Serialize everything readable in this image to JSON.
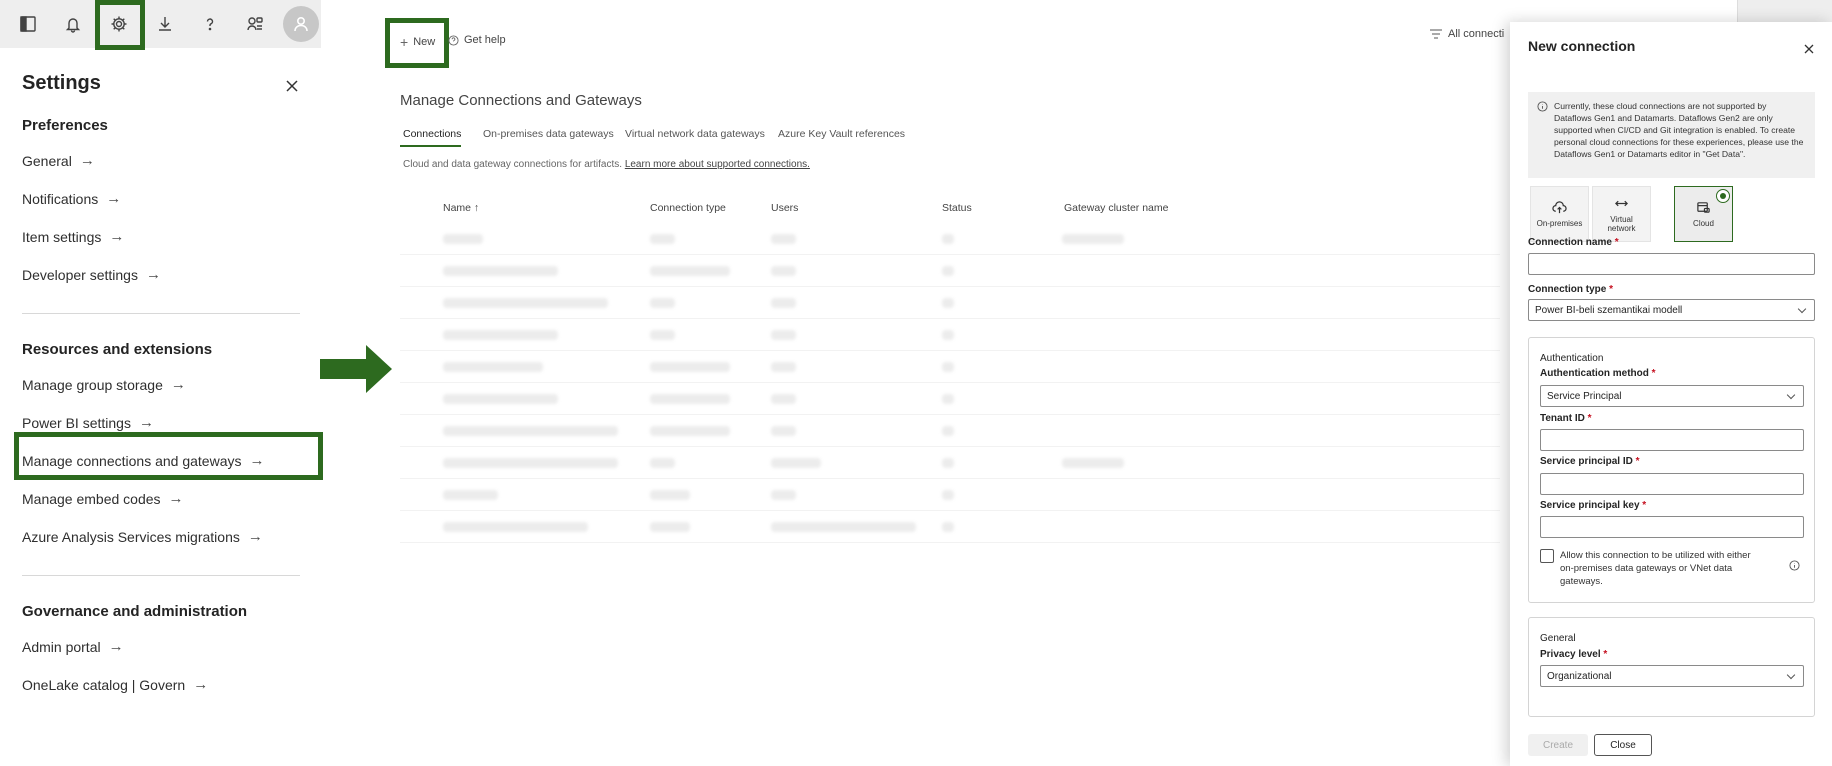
{
  "settings": {
    "title": "Settings",
    "preferences": {
      "heading": "Preferences",
      "links": [
        "General",
        "Notifications",
        "Item settings",
        "Developer settings"
      ]
    },
    "resources": {
      "heading": "Resources and extensions",
      "links": [
        "Manage group storage",
        "Power BI settings",
        "Manage connections and gateways",
        "Manage embed codes",
        "Azure Analysis Services migrations"
      ]
    },
    "governance": {
      "heading": "Governance and administration",
      "links": [
        "Admin portal",
        "OneLake catalog | Govern"
      ]
    }
  },
  "toolbar": {
    "new_label": "New",
    "help_label": "Get help",
    "filter_label": "All connecti"
  },
  "main": {
    "heading": "Manage Connections and Gateways",
    "tabs": [
      "Connections",
      "On-premises data gateways",
      "Virtual network data gateways",
      "Azure Key Vault references"
    ],
    "description": "Cloud and data gateway connections for artifacts.",
    "description_link": "Learn more about supported connections.",
    "columns": [
      "Name ↑",
      "Connection type",
      "Users",
      "Status",
      "Gateway cluster name"
    ]
  },
  "panel": {
    "title": "New connection",
    "info_text": "Currently, these cloud connections are not supported by Dataflows Gen1 and Datamarts. Dataflows Gen2 are only supported when CI/CD and Git integration is enabled. To create personal cloud connections for these experiences, please use the Dataflows Gen1 or Datamarts editor in \"Get Data\".",
    "options": [
      "On-premises",
      "Virtual network",
      "Cloud"
    ],
    "connection_name_label": "Connection name",
    "connection_name_value": "",
    "connection_type_label": "Connection type",
    "connection_type_value": "Power BI-beli szemantikai modell",
    "auth": {
      "title": "Authentication",
      "method_label": "Authentication method",
      "method_value": "Service Principal",
      "tenant_label": "Tenant ID",
      "sp_id_label": "Service principal ID",
      "sp_key_label": "Service principal key",
      "allow_text": "Allow this connection to be utilized with either on-premises data gateways or VNet data gateways."
    },
    "general": {
      "title": "General",
      "privacy_label": "Privacy level",
      "privacy_value": "Organizational"
    },
    "create_label": "Create",
    "close_label": "Close",
    "required_mark": "*"
  },
  "colors": {
    "highlight": "#2d6a1f",
    "required": "#c50f1f"
  }
}
